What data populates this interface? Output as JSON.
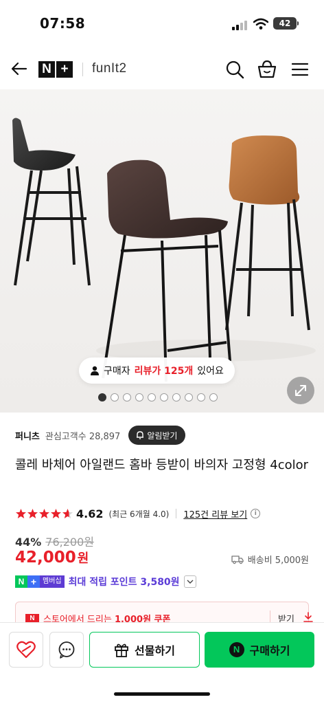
{
  "status_bar": {
    "time": "07:58",
    "battery": "42"
  },
  "header": {
    "logo_n": "N",
    "logo_plus": "+",
    "brand": "funIt2",
    "icons": [
      "back-arrow-icon",
      "search-icon",
      "shopping-basket-icon",
      "menu-icon"
    ]
  },
  "hero": {
    "review_prefix": "구매자",
    "review_highlight": "리뷰가 125개",
    "review_suffix": "있어요",
    "slide_count": 10,
    "active_slide": 0
  },
  "seller": {
    "name": "퍼니츠",
    "fans_label": "관심고객수 28,897",
    "alarm_label": "알림받기"
  },
  "product": {
    "title": "콜레 바체어 아일랜드 홈바 등받이 바의자 고정형 4color",
    "rating": "4.62",
    "rating_stars": 4.62,
    "rating_recent": "(최근 6개월 4.0)",
    "review_link": "125건 리뷰 보기",
    "discount": "44%",
    "original_price": "76,200원",
    "price": "42,000",
    "price_unit": "원",
    "shipping": "배송비 5,000원"
  },
  "points": {
    "badge_n": "N",
    "badge_plus": "+",
    "badge_label": "멤버십",
    "text": "최대 적립 포인트 3,580원"
  },
  "coupon": {
    "badge": "N",
    "text_prefix": "스토어에서 드리는",
    "text_bold": "1,000원 쿠폰",
    "action": "받기"
  },
  "bottom_bar": {
    "gift_label": "선물하기",
    "buy_label": "구매하기",
    "buy_badge": "N"
  },
  "colors": {
    "accent_red": "#e8202a",
    "naver_green": "#03c75a",
    "membership_purple": "#5b3cd7"
  }
}
